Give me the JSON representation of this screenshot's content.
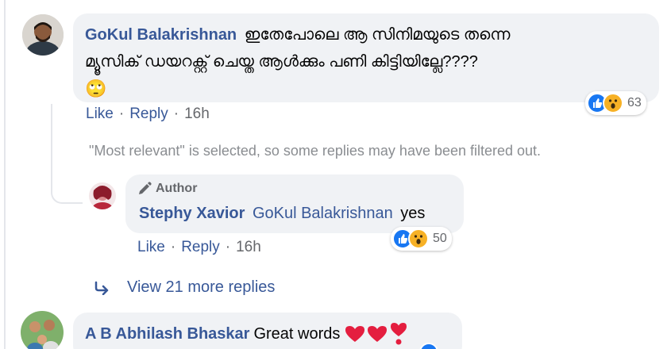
{
  "comments": [
    {
      "author": "GoKul Balakrishnan",
      "text_line1": "ഇതേപോലെ ആ സിനിമയുടെ തന്നെ",
      "text_line2": "മ്യൂസിക് ഡയറക്റ്റ് ചെയ്ത ആൾക്കും പണി കിട്ടിയില്ലേ????",
      "emoji": "🙄",
      "like_label": "Like",
      "reply_label": "Reply",
      "time": "16h",
      "reaction_count": "63"
    }
  ],
  "filter_notice": "\"Most relevant\" is selected, so some replies may have been filtered out.",
  "reply": {
    "badge": "Author",
    "author": "Stephy Xavior",
    "mention": "GoKul Balakrishnan",
    "text": "yes",
    "like_label": "Like",
    "reply_label": "Reply",
    "time": "16h",
    "reaction_count": "50"
  },
  "view_more": "View 21 more replies",
  "comment2": {
    "author": "A B Abhilash Bhaskar",
    "text": "Great words"
  },
  "colors": {
    "link": "#385898",
    "bubble": "#f0f2f5",
    "like_blue": "#1877f2",
    "wow_yellow": "#f7b125",
    "heart_red": "#e41e3f"
  }
}
